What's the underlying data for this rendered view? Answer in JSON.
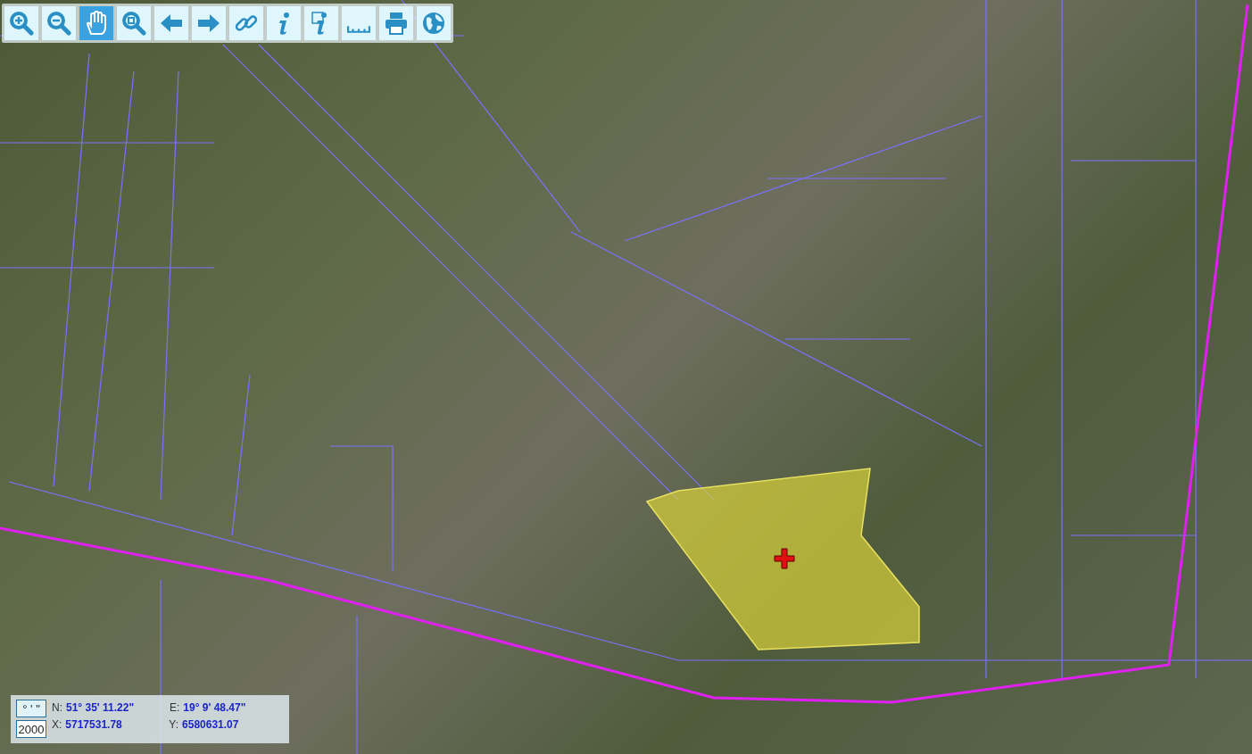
{
  "toolbar": {
    "tools": [
      {
        "kind": "zoom-in",
        "selected": false
      },
      {
        "kind": "zoom-out",
        "selected": false
      },
      {
        "kind": "pan",
        "selected": true
      },
      {
        "kind": "zoom-extent",
        "selected": false
      },
      {
        "kind": "back",
        "selected": false
      },
      {
        "kind": "forward",
        "selected": false
      },
      {
        "kind": "link",
        "selected": false
      },
      {
        "kind": "info",
        "selected": false
      },
      {
        "kind": "info-area",
        "selected": false
      },
      {
        "kind": "measure",
        "selected": false
      },
      {
        "kind": "print",
        "selected": false
      },
      {
        "kind": "globe",
        "selected": false
      }
    ]
  },
  "coordinates": {
    "formats": [
      {
        "label": "° ' \"",
        "selected": true
      },
      {
        "label": "2000",
        "selected": false
      }
    ],
    "rows": [
      {
        "a_label": "N:",
        "a_value": "51° 35' 11.22\"",
        "b_label": "E:",
        "b_value": "19° 9' 48.47\""
      },
      {
        "a_label": "X:",
        "a_value": "5717531.78",
        "b_label": "Y:",
        "b_value": "6580631.07"
      }
    ]
  }
}
